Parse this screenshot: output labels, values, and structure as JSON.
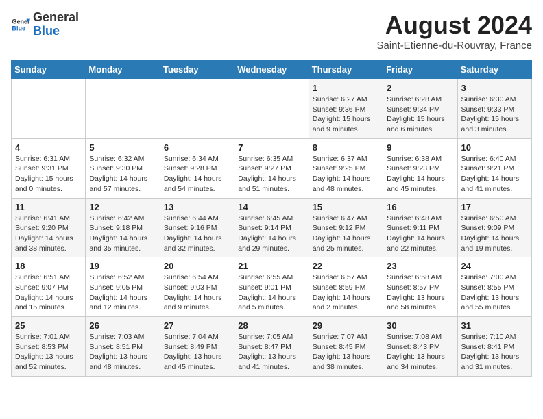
{
  "header": {
    "title": "August 2024",
    "location": "Saint-Etienne-du-Rouvray, France",
    "logo_general": "General",
    "logo_blue": "Blue"
  },
  "days_of_week": [
    "Sunday",
    "Monday",
    "Tuesday",
    "Wednesday",
    "Thursday",
    "Friday",
    "Saturday"
  ],
  "weeks": [
    [
      {
        "day": "",
        "info": ""
      },
      {
        "day": "",
        "info": ""
      },
      {
        "day": "",
        "info": ""
      },
      {
        "day": "",
        "info": ""
      },
      {
        "day": "1",
        "info": "Sunrise: 6:27 AM\nSunset: 9:36 PM\nDaylight: 15 hours and 9 minutes."
      },
      {
        "day": "2",
        "info": "Sunrise: 6:28 AM\nSunset: 9:34 PM\nDaylight: 15 hours and 6 minutes."
      },
      {
        "day": "3",
        "info": "Sunrise: 6:30 AM\nSunset: 9:33 PM\nDaylight: 15 hours and 3 minutes."
      }
    ],
    [
      {
        "day": "4",
        "info": "Sunrise: 6:31 AM\nSunset: 9:31 PM\nDaylight: 15 hours and 0 minutes."
      },
      {
        "day": "5",
        "info": "Sunrise: 6:32 AM\nSunset: 9:30 PM\nDaylight: 14 hours and 57 minutes."
      },
      {
        "day": "6",
        "info": "Sunrise: 6:34 AM\nSunset: 9:28 PM\nDaylight: 14 hours and 54 minutes."
      },
      {
        "day": "7",
        "info": "Sunrise: 6:35 AM\nSunset: 9:27 PM\nDaylight: 14 hours and 51 minutes."
      },
      {
        "day": "8",
        "info": "Sunrise: 6:37 AM\nSunset: 9:25 PM\nDaylight: 14 hours and 48 minutes."
      },
      {
        "day": "9",
        "info": "Sunrise: 6:38 AM\nSunset: 9:23 PM\nDaylight: 14 hours and 45 minutes."
      },
      {
        "day": "10",
        "info": "Sunrise: 6:40 AM\nSunset: 9:21 PM\nDaylight: 14 hours and 41 minutes."
      }
    ],
    [
      {
        "day": "11",
        "info": "Sunrise: 6:41 AM\nSunset: 9:20 PM\nDaylight: 14 hours and 38 minutes."
      },
      {
        "day": "12",
        "info": "Sunrise: 6:42 AM\nSunset: 9:18 PM\nDaylight: 14 hours and 35 minutes."
      },
      {
        "day": "13",
        "info": "Sunrise: 6:44 AM\nSunset: 9:16 PM\nDaylight: 14 hours and 32 minutes."
      },
      {
        "day": "14",
        "info": "Sunrise: 6:45 AM\nSunset: 9:14 PM\nDaylight: 14 hours and 29 minutes."
      },
      {
        "day": "15",
        "info": "Sunrise: 6:47 AM\nSunset: 9:12 PM\nDaylight: 14 hours and 25 minutes."
      },
      {
        "day": "16",
        "info": "Sunrise: 6:48 AM\nSunset: 9:11 PM\nDaylight: 14 hours and 22 minutes."
      },
      {
        "day": "17",
        "info": "Sunrise: 6:50 AM\nSunset: 9:09 PM\nDaylight: 14 hours and 19 minutes."
      }
    ],
    [
      {
        "day": "18",
        "info": "Sunrise: 6:51 AM\nSunset: 9:07 PM\nDaylight: 14 hours and 15 minutes."
      },
      {
        "day": "19",
        "info": "Sunrise: 6:52 AM\nSunset: 9:05 PM\nDaylight: 14 hours and 12 minutes."
      },
      {
        "day": "20",
        "info": "Sunrise: 6:54 AM\nSunset: 9:03 PM\nDaylight: 14 hours and 9 minutes."
      },
      {
        "day": "21",
        "info": "Sunrise: 6:55 AM\nSunset: 9:01 PM\nDaylight: 14 hours and 5 minutes."
      },
      {
        "day": "22",
        "info": "Sunrise: 6:57 AM\nSunset: 8:59 PM\nDaylight: 14 hours and 2 minutes."
      },
      {
        "day": "23",
        "info": "Sunrise: 6:58 AM\nSunset: 8:57 PM\nDaylight: 13 hours and 58 minutes."
      },
      {
        "day": "24",
        "info": "Sunrise: 7:00 AM\nSunset: 8:55 PM\nDaylight: 13 hours and 55 minutes."
      }
    ],
    [
      {
        "day": "25",
        "info": "Sunrise: 7:01 AM\nSunset: 8:53 PM\nDaylight: 13 hours and 52 minutes."
      },
      {
        "day": "26",
        "info": "Sunrise: 7:03 AM\nSunset: 8:51 PM\nDaylight: 13 hours and 48 minutes."
      },
      {
        "day": "27",
        "info": "Sunrise: 7:04 AM\nSunset: 8:49 PM\nDaylight: 13 hours and 45 minutes."
      },
      {
        "day": "28",
        "info": "Sunrise: 7:05 AM\nSunset: 8:47 PM\nDaylight: 13 hours and 41 minutes."
      },
      {
        "day": "29",
        "info": "Sunrise: 7:07 AM\nSunset: 8:45 PM\nDaylight: 13 hours and 38 minutes."
      },
      {
        "day": "30",
        "info": "Sunrise: 7:08 AM\nSunset: 8:43 PM\nDaylight: 13 hours and 34 minutes."
      },
      {
        "day": "31",
        "info": "Sunrise: 7:10 AM\nSunset: 8:41 PM\nDaylight: 13 hours and 31 minutes."
      }
    ]
  ]
}
